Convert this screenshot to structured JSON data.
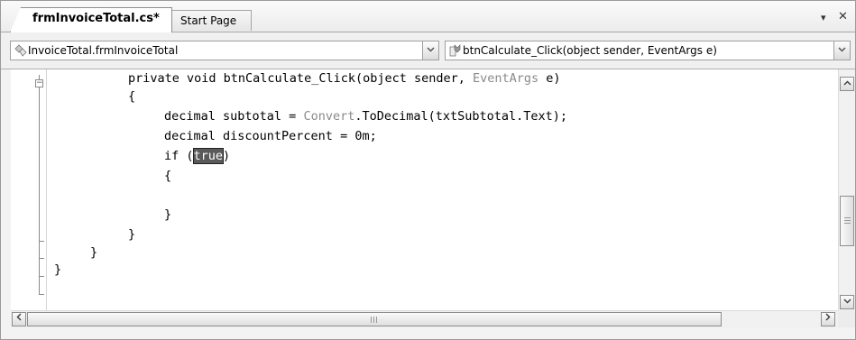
{
  "tabs": [
    {
      "label": "frmInvoiceTotal.cs*",
      "active": true
    },
    {
      "label": "Start Page",
      "active": false
    }
  ],
  "tab_controls": {
    "dropdown_glyph": "▾",
    "close_glyph": "✕"
  },
  "navbar": {
    "class_combo": {
      "value": "InvoiceTotal.frmInvoiceTotal",
      "icon": "class-icon"
    },
    "member_combo": {
      "value": "btnCalculate_Click(object sender, EventArgs e)",
      "icon": "method-icon"
    }
  },
  "code": {
    "line1": {
      "pre": "private void btnCalculate_Click(object sender, ",
      "type": "EventArgs",
      "post": " e)"
    },
    "line2": "{",
    "line3": {
      "pre": "decimal subtotal = ",
      "type": "Convert",
      "post": ".ToDecimal(txtSubtotal.Text);"
    },
    "line4": "decimal discountPercent = 0m;",
    "line5": {
      "pre": "if (",
      "selected": "true",
      "post": ")"
    },
    "line6": "{",
    "line7": "}",
    "line8": "}",
    "line9": "}",
    "line10": "}"
  },
  "colors": {
    "type_name": "#8a8a8a",
    "selection": "#5a5a5a",
    "text": "#000000"
  }
}
